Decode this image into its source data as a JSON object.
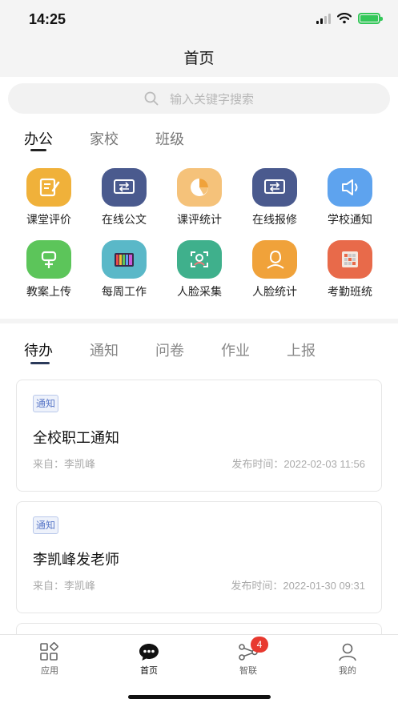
{
  "status": {
    "time": "14:25"
  },
  "header": {
    "title": "首页"
  },
  "search": {
    "placeholder": "输入关键字搜索"
  },
  "category_tabs": [
    {
      "label": "办公",
      "active": true
    },
    {
      "label": "家校",
      "active": false
    },
    {
      "label": "班级",
      "active": false
    }
  ],
  "apps": [
    {
      "label": "课堂评价",
      "icon": "edit-note-icon",
      "color": "#f0b13a"
    },
    {
      "label": "在线公文",
      "icon": "document-transfer-icon",
      "color": "#4a5a8e"
    },
    {
      "label": "课评统计",
      "icon": "pie-chart-icon",
      "color": "#f5c27a"
    },
    {
      "label": "在线报修",
      "icon": "repair-transfer-icon",
      "color": "#4a5a8e"
    },
    {
      "label": "学校通知",
      "icon": "speaker-icon",
      "color": "#5ea3ee"
    },
    {
      "label": "教案上传",
      "icon": "upload-plan-icon",
      "color": "#5cc55a"
    },
    {
      "label": "每周工作",
      "icon": "tv-schedule-icon",
      "color": "#5ab8c8"
    },
    {
      "label": "人脸采集",
      "icon": "face-scan-icon",
      "color": "#3fb08c"
    },
    {
      "label": "人脸统计",
      "icon": "face-profile-icon",
      "color": "#f0a23a"
    },
    {
      "label": "考勤班统",
      "icon": "attendance-grid-icon",
      "color": "#e86a4a"
    }
  ],
  "todo_tabs": [
    {
      "label": "待办",
      "active": true
    },
    {
      "label": "通知",
      "active": false
    },
    {
      "label": "问卷",
      "active": false
    },
    {
      "label": "作业",
      "active": false
    },
    {
      "label": "上报",
      "active": false
    }
  ],
  "cards": [
    {
      "tag": "通知",
      "title": "全校职工通知",
      "from": "来自：李凯峰",
      "time": "发布时间：2022-02-03 11:56"
    },
    {
      "tag": "通知",
      "title": "李凯峰发老师",
      "from": "来自：李凯峰",
      "time": "发布时间：2022-01-30 09:31"
    }
  ],
  "tab_bar": [
    {
      "label": "应用",
      "icon": "apps-grid-icon",
      "active": false
    },
    {
      "label": "首页",
      "icon": "chat-bubble-icon",
      "active": true
    },
    {
      "label": "智联",
      "icon": "share-network-icon",
      "active": false,
      "badge": "4"
    },
    {
      "label": "我的",
      "icon": "person-icon",
      "active": false
    }
  ]
}
